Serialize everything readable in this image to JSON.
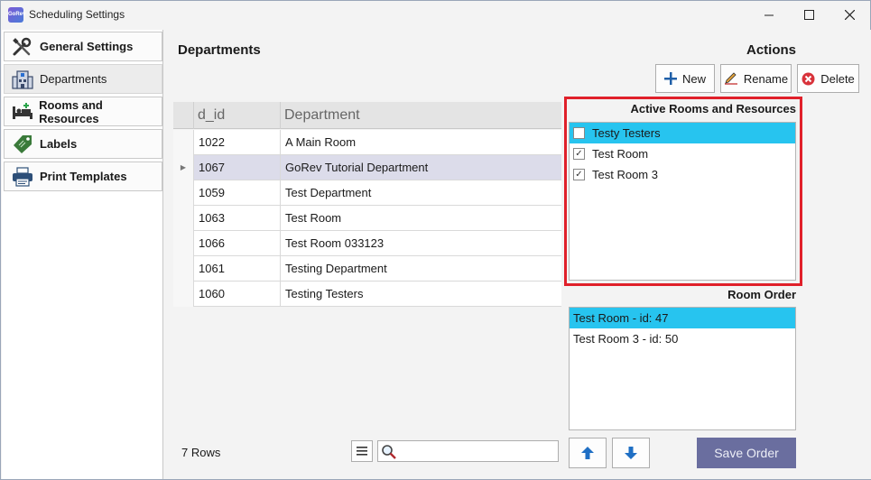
{
  "window": {
    "title": "Scheduling Settings",
    "icon_text": "GoRev"
  },
  "sidebar": {
    "items": [
      {
        "label": "General Settings",
        "icon": "tools-icon",
        "active": false
      },
      {
        "label": "Departments",
        "icon": "building-icon",
        "active": true
      },
      {
        "label": "Rooms and Resources",
        "icon": "bed-icon",
        "active": false
      },
      {
        "label": "Labels",
        "icon": "tag-icon",
        "active": false
      },
      {
        "label": "Print Templates",
        "icon": "printer-icon",
        "active": false
      }
    ]
  },
  "main": {
    "departments_heading": "Departments",
    "actions_heading": "Actions",
    "buttons": {
      "new": "New",
      "rename": "Rename",
      "delete": "Delete"
    },
    "grid": {
      "columns": [
        "d_id",
        "Department"
      ],
      "rows": [
        {
          "id": "1022",
          "name": "A Main Room",
          "selected": false
        },
        {
          "id": "1067",
          "name": "GoRev Tutorial Department",
          "selected": true
        },
        {
          "id": "1059",
          "name": "Test Department",
          "selected": false
        },
        {
          "id": "1063",
          "name": "Test Room",
          "selected": false
        },
        {
          "id": "1066",
          "name": "Test Room 033123",
          "selected": false
        },
        {
          "id": "1061",
          "name": "Testing Department",
          "selected": false
        },
        {
          "id": "1060",
          "name": "Testing Testers",
          "selected": false
        }
      ]
    },
    "rows_count": "7 Rows",
    "search": {
      "value": "",
      "placeholder": ""
    },
    "active_rooms": {
      "label": "Active Rooms and Resources",
      "items": [
        {
          "label": "Testy Testers",
          "checked": false,
          "selected": true
        },
        {
          "label": "Test Room",
          "checked": true,
          "selected": false
        },
        {
          "label": "Test Room 3",
          "checked": true,
          "selected": false
        }
      ]
    },
    "room_order": {
      "label": "Room Order",
      "items": [
        {
          "label": "Test Room - id: 47",
          "selected": true
        },
        {
          "label": "Test Room 3 - id: 50",
          "selected": false
        }
      ]
    },
    "save_order": "Save Order"
  },
  "colors": {
    "selection_blue": "#27c4ef",
    "highlight_red": "#e0202a",
    "save_button": "#6a6e9f",
    "grid_selected_row": "#dcdcea"
  }
}
